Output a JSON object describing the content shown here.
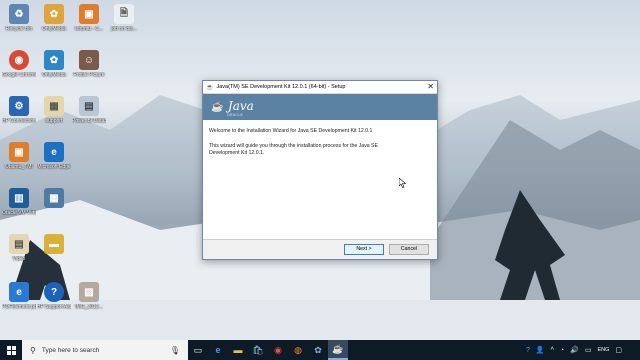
{
  "desktop_icons": [
    {
      "id": "recycle",
      "label": "Recycle Bin",
      "color": "#5d86b3",
      "glyph": "♻"
    },
    {
      "id": "onlymedia",
      "label": "OnlyMedia",
      "color": "#e0a43b",
      "glyph": "✿"
    },
    {
      "id": "ubuntu",
      "label": "Ubuntu - C...",
      "color": "#e07d2c",
      "glyph": "▣"
    },
    {
      "id": "job",
      "label": "job on dis...",
      "color": "#e9eef3",
      "glyph": "🗎"
    },
    {
      "id": "chrome",
      "label": "Google Chrome",
      "color": "#d64b38",
      "glyph": "◉"
    },
    {
      "id": "onlymedia2",
      "label": "OnlyMedia",
      "color": "#2f86c7",
      "glyph": "✿"
    },
    {
      "id": "profile",
      "label": "Profile Picture",
      "color": "#7a5a4a",
      "glyph": "☺"
    },
    {
      "id": "hpconn",
      "label": "HP Connection...",
      "color": "#2a66b3",
      "glyph": "⚙"
    },
    {
      "id": "support",
      "label": "support",
      "color": "#e4d6a8",
      "glyph": "▦"
    },
    {
      "id": "power",
      "label": "Power BI DataSets",
      "color": "#bac8d6",
      "glyph": "▤"
    },
    {
      "id": "ubuntu2",
      "label": "Ubuntu_TMI",
      "color": "#e07d2c",
      "glyph": "▣"
    },
    {
      "id": "edge",
      "label": "Microsoft Edge",
      "color": "#1d6fc1",
      "glyph": "e"
    },
    {
      "id": "oracle",
      "label": "Oracle VM VirtualBox",
      "color": "#1e5d9a",
      "glyph": "▥"
    },
    {
      "id": "grid",
      "label": "",
      "color": "#4e7aa6",
      "glyph": "▦"
    },
    {
      "id": "video",
      "label": "Video",
      "color": "#e3d6b3",
      "glyph": "▤"
    },
    {
      "id": "folder",
      "label": "",
      "color": "#d9b13a",
      "glyph": "▬"
    },
    {
      "id": "pdf",
      "label": "PDFelement pdf",
      "color": "#2a79d2",
      "glyph": "e"
    },
    {
      "id": "hpsupport",
      "label": "HP Support Assistant",
      "color": "#1b63b8",
      "glyph": "?"
    },
    {
      "id": "img",
      "label": "IMG_2012...",
      "color": "#b5a89c",
      "glyph": "▨"
    }
  ],
  "window": {
    "title": "Java(TM) SE Development Kit 12.0.1 (64-bit) - Setup",
    "logo_text": "Java",
    "logo_sub": "ORACLE",
    "welcome": "Welcome to the Installation Wizard for Java SE Development Kit 12.0.1",
    "body": "This wizard will guide you through the installation process for the Java SE Development Kit 12.0.1.",
    "next_label": "Next >",
    "cancel_label": "Cancel"
  },
  "taskbar": {
    "search_placeholder": "Type here to search",
    "language": "ENG"
  }
}
